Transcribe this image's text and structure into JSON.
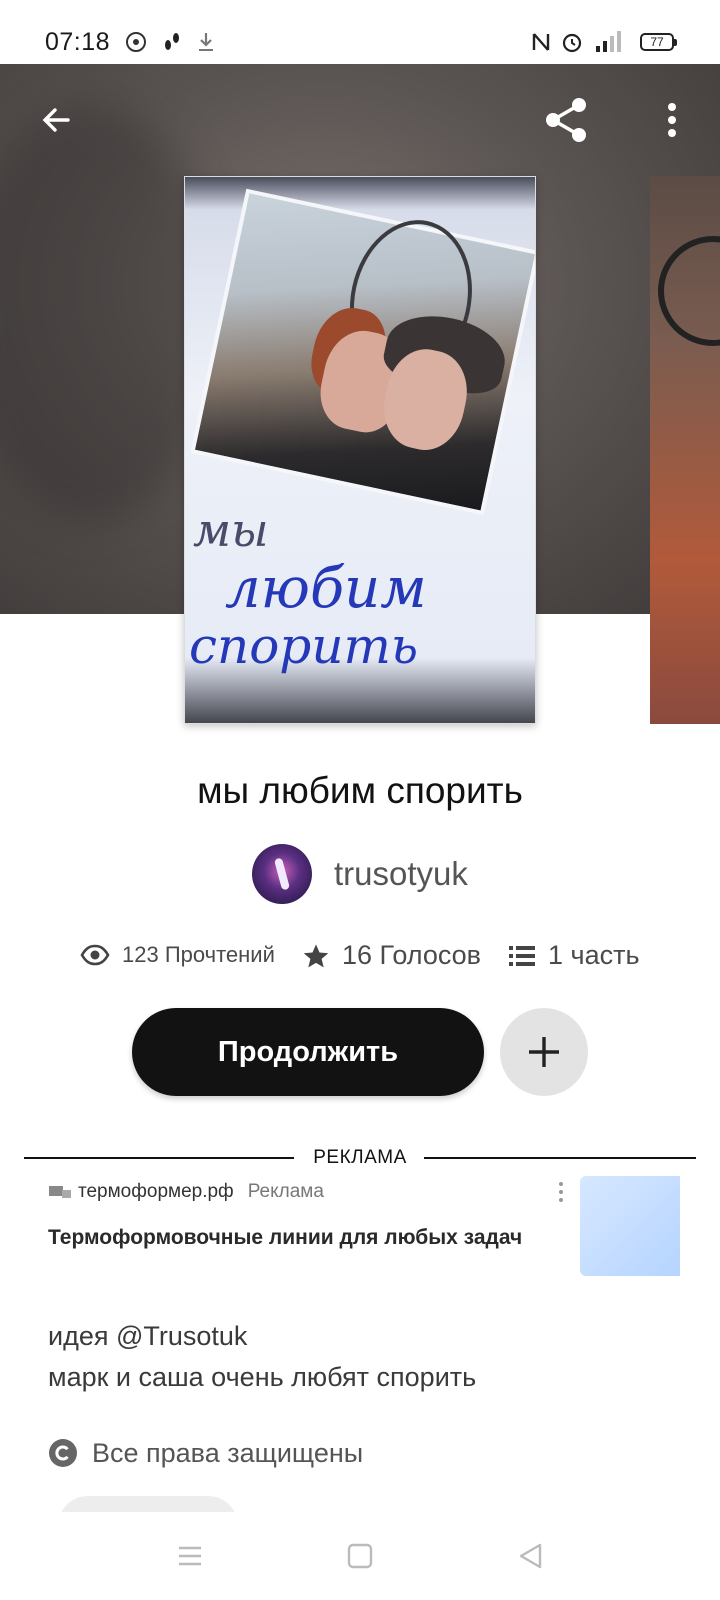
{
  "status_bar": {
    "time": "07:18",
    "battery": "77"
  },
  "story": {
    "title": "мы любим спорить",
    "cover_text": [
      "мы",
      "любим",
      "спорить"
    ],
    "author": "trusotyuk",
    "stats": {
      "reads": "123 Прочтений",
      "votes": "16 Голосов",
      "parts": "1 часть"
    },
    "continue_label": "Продолжить",
    "description_lines": [
      "идея @Trusotuk",
      "марк и саша очень любят спорить"
    ],
    "copyright": "Все права защищены"
  },
  "ad": {
    "section_label": "РЕКЛАМА",
    "site": "термоформер.рф",
    "tag": "Реклама",
    "title": "Термоформовочные линии для любых задач"
  },
  "icons": {
    "back": "arrow-left-icon",
    "share": "share-icon",
    "more": "more-vertical-icon",
    "reads": "eye-icon",
    "votes": "star-icon",
    "parts": "list-icon",
    "add": "plus-icon",
    "copyright": "copyright-icon"
  }
}
